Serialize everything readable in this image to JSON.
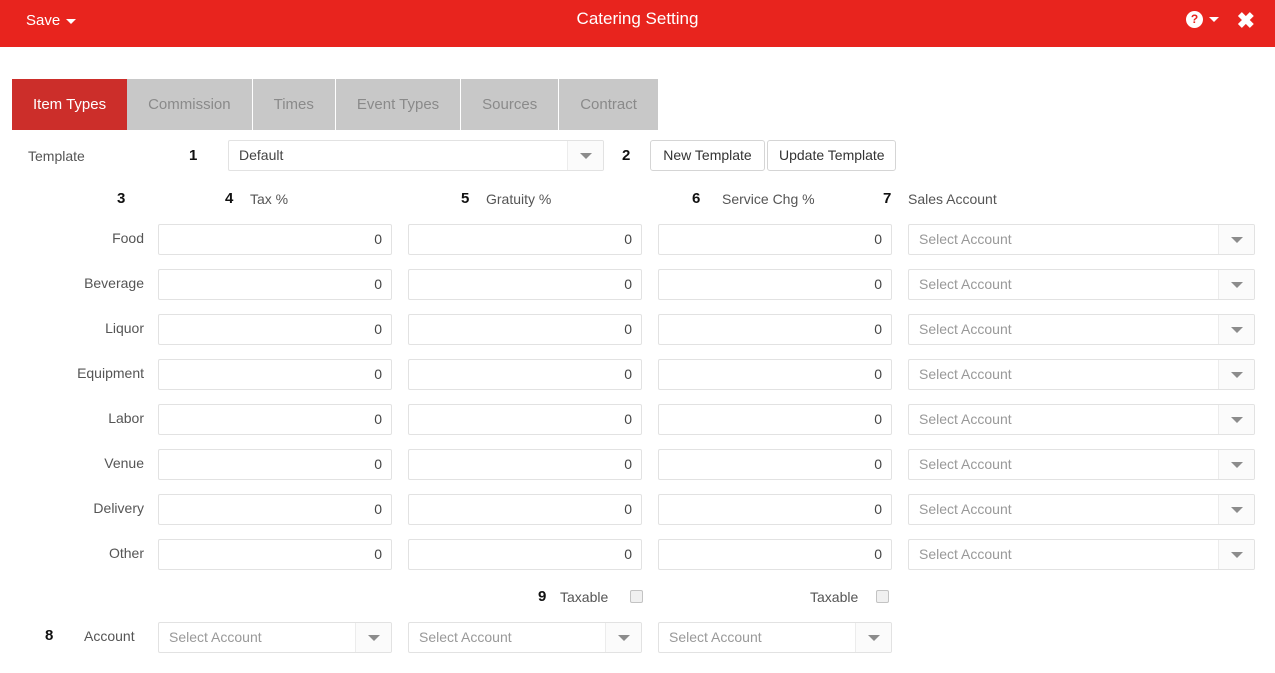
{
  "titlebar": {
    "save_label": "Save",
    "title": "Catering Setting",
    "help_glyph": "?",
    "close_glyph": "✖"
  },
  "tabs": [
    {
      "label": "Item Types",
      "active": true
    },
    {
      "label": "Commission",
      "active": false
    },
    {
      "label": "Times",
      "active": false
    },
    {
      "label": "Event Types",
      "active": false
    },
    {
      "label": "Sources",
      "active": false
    },
    {
      "label": "Contract",
      "active": false
    }
  ],
  "template_row": {
    "label": "Template",
    "anno_select": "1",
    "selected": "Default",
    "anno_buttons": "2",
    "new_button": "New Template",
    "update_button": "Update Template"
  },
  "column_headers": {
    "anno_rowlabel": "3",
    "anno_tax": "4",
    "tax": "Tax %",
    "anno_gratuity": "5",
    "gratuity": "Gratuity %",
    "anno_service": "6",
    "service": "Service Chg %",
    "anno_sales": "7",
    "sales": "Sales Account"
  },
  "rows": [
    {
      "label": "Food",
      "tax": "0",
      "gratuity": "0",
      "service": "0",
      "account": "Select Account"
    },
    {
      "label": "Beverage",
      "tax": "0",
      "gratuity": "0",
      "service": "0",
      "account": "Select Account"
    },
    {
      "label": "Liquor",
      "tax": "0",
      "gratuity": "0",
      "service": "0",
      "account": "Select Account"
    },
    {
      "label": "Equipment",
      "tax": "0",
      "gratuity": "0",
      "service": "0",
      "account": "Select Account"
    },
    {
      "label": "Labor",
      "tax": "0",
      "gratuity": "0",
      "service": "0",
      "account": "Select Account"
    },
    {
      "label": "Venue",
      "tax": "0",
      "gratuity": "0",
      "service": "0",
      "account": "Select Account"
    },
    {
      "label": "Delivery",
      "tax": "0",
      "gratuity": "0",
      "service": "0",
      "account": "Select Account"
    },
    {
      "label": "Other",
      "tax": "0",
      "gratuity": "0",
      "service": "0",
      "account": "Select Account"
    }
  ],
  "taxable_row": {
    "anno": "9",
    "gratuity_label": "Taxable",
    "gratuity_checked": false,
    "service_label": "Taxable",
    "service_checked": false
  },
  "account_row": {
    "anno": "8",
    "label": "Account",
    "tax_account": "Select Account",
    "gratuity_account": "Select Account",
    "service_account": "Select Account"
  },
  "colors": {
    "header_red": "#e8241e",
    "active_tab_red": "#cc2e2a",
    "inactive_tab_grey": "#c8c8c8",
    "inactive_tab_text": "#8a8a8a",
    "label_text": "#555555",
    "placeholder_text": "#999999",
    "input_border": "#e2e2e2"
  }
}
